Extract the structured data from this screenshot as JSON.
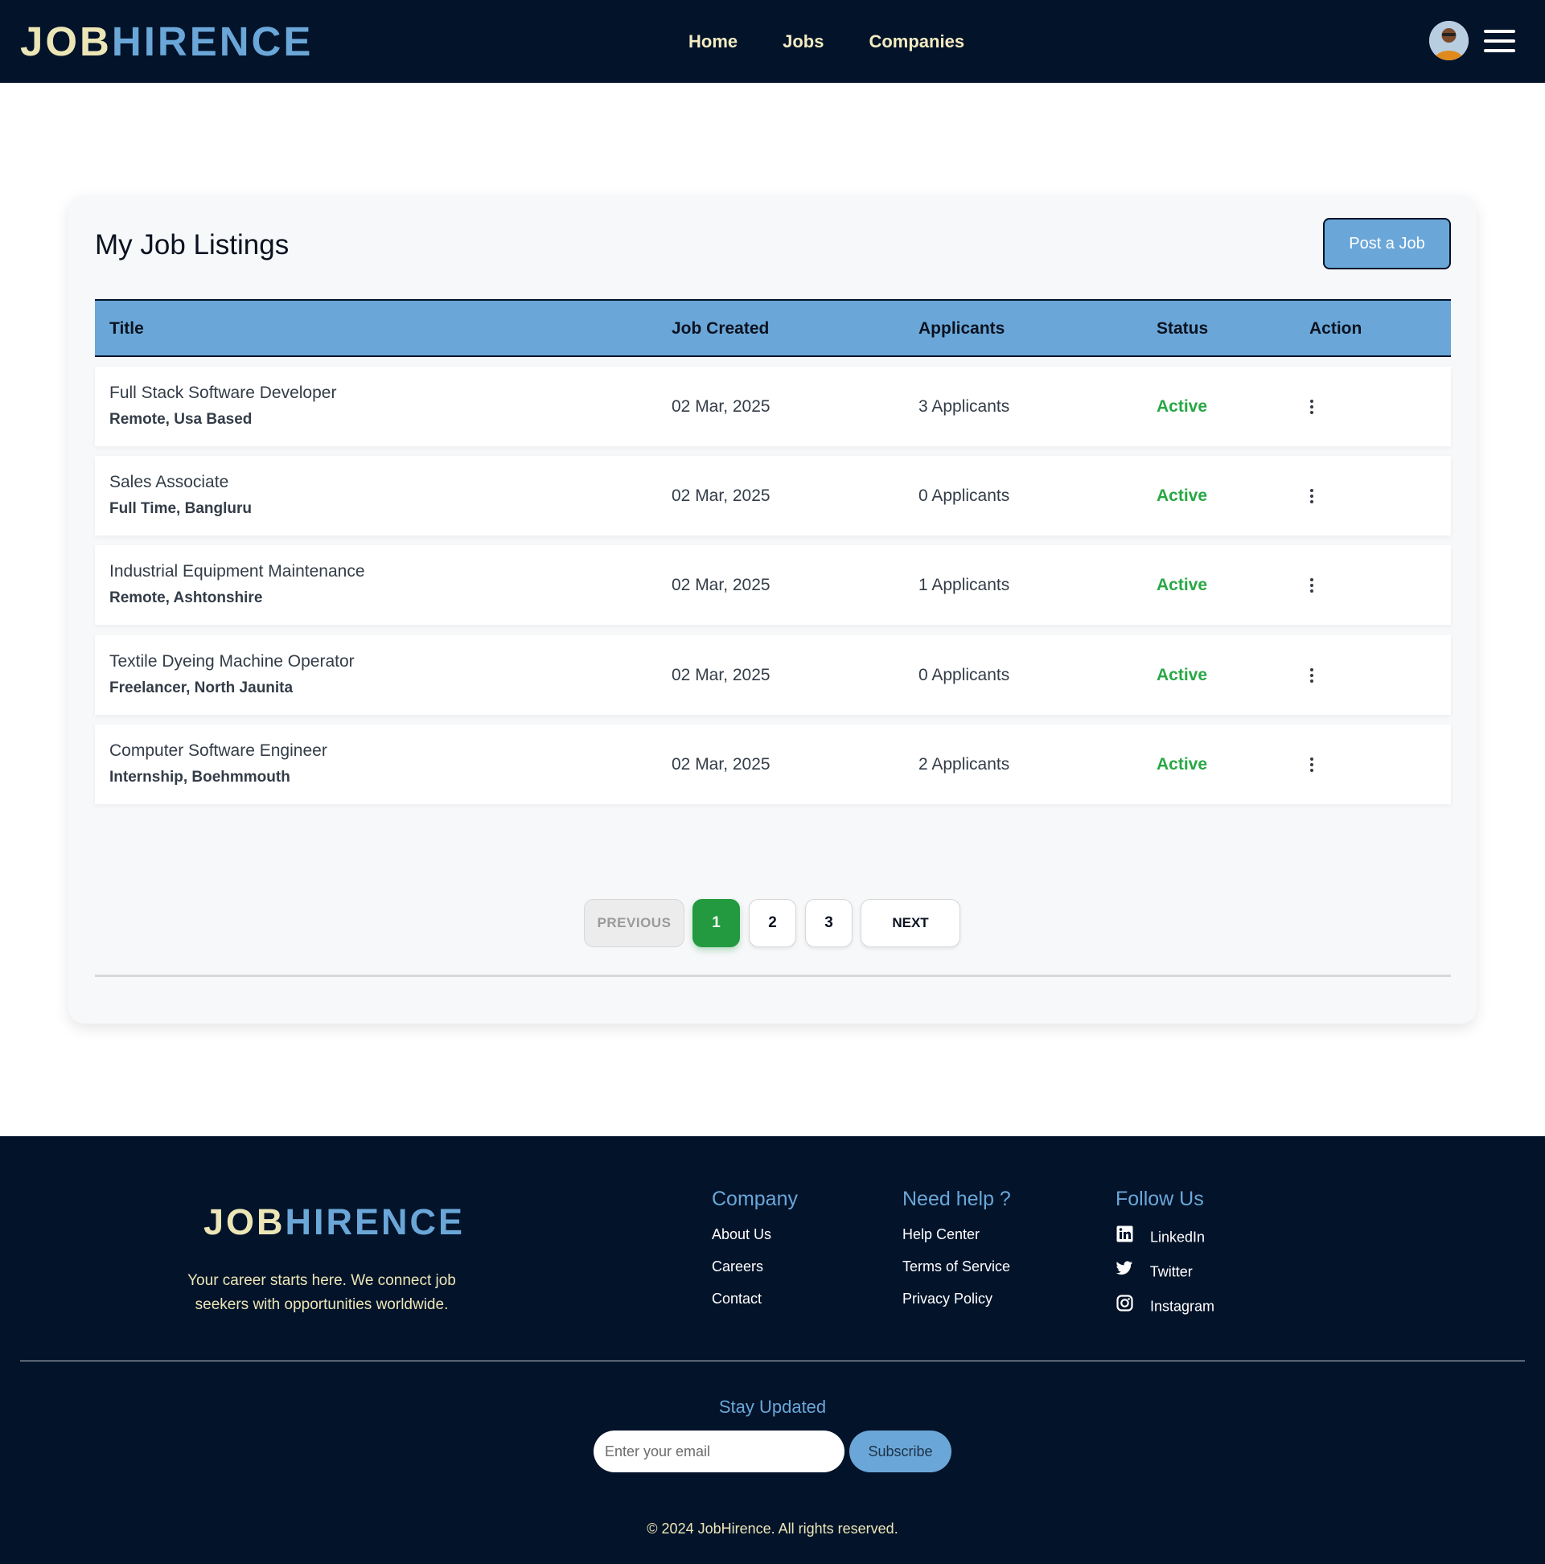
{
  "header": {
    "brand_part1": "JOB",
    "brand_part2": "HIRENCE",
    "nav": [
      "Home",
      "Jobs",
      "Companies"
    ],
    "avatar_icon": "user-avatar",
    "menu_icon": "hamburger-menu-icon"
  },
  "listings": {
    "title": "My Job Listings",
    "post_button": "Post a Job",
    "columns": [
      "Title",
      "Job Created",
      "Applicants",
      "Status",
      "Action"
    ],
    "rows": [
      {
        "title": "Full Stack Software Developer",
        "sub": "Remote, Usa Based",
        "date": "02 Mar, 2025",
        "applicants": "3 Applicants",
        "status": "Active"
      },
      {
        "title": "Sales Associate",
        "sub": "Full Time, Bangluru",
        "date": "02 Mar, 2025",
        "applicants": "0 Applicants",
        "status": "Active"
      },
      {
        "title": "Industrial Equipment Maintenance",
        "sub": "Remote, Ashtonshire",
        "date": "02 Mar, 2025",
        "applicants": "1 Applicants",
        "status": "Active"
      },
      {
        "title": "Textile Dyeing Machine Operator",
        "sub": "Freelancer, North Jaunita",
        "date": "02 Mar, 2025",
        "applicants": "0 Applicants",
        "status": "Active"
      },
      {
        "title": "Computer Software Engineer",
        "sub": "Internship, Boehmmouth",
        "date": "02 Mar, 2025",
        "applicants": "2 Applicants",
        "status": "Active"
      }
    ],
    "action_icon": "more-vertical-icon"
  },
  "pagination": {
    "previous": "PREVIOUS",
    "pages": [
      "1",
      "2",
      "3"
    ],
    "current": "1",
    "next": "NEXT"
  },
  "footer": {
    "brand_part1": "JOB",
    "brand_part2": "HIRENCE",
    "tagline": "Your career starts here. We connect job seekers with opportunities worldwide.",
    "company": {
      "heading": "Company",
      "links": [
        "About Us",
        "Careers",
        "Contact"
      ]
    },
    "help": {
      "heading": "Need help ?",
      "links": [
        "Help Center",
        "Terms of Service",
        "Privacy Policy"
      ]
    },
    "follow": {
      "heading": "Follow Us",
      "links": [
        "LinkedIn",
        "Twitter",
        "Instagram"
      ]
    },
    "newsletter": {
      "heading": "Stay Updated",
      "placeholder": "Enter your email",
      "button": "Subscribe"
    },
    "copyright": "© 2024 JobHirence. All rights reserved."
  },
  "colors": {
    "navy": "#03132a",
    "accent_blue": "#6aa7d8",
    "cream": "#ece6b6",
    "active_green": "#28a745",
    "page_active": "#239a3f"
  }
}
